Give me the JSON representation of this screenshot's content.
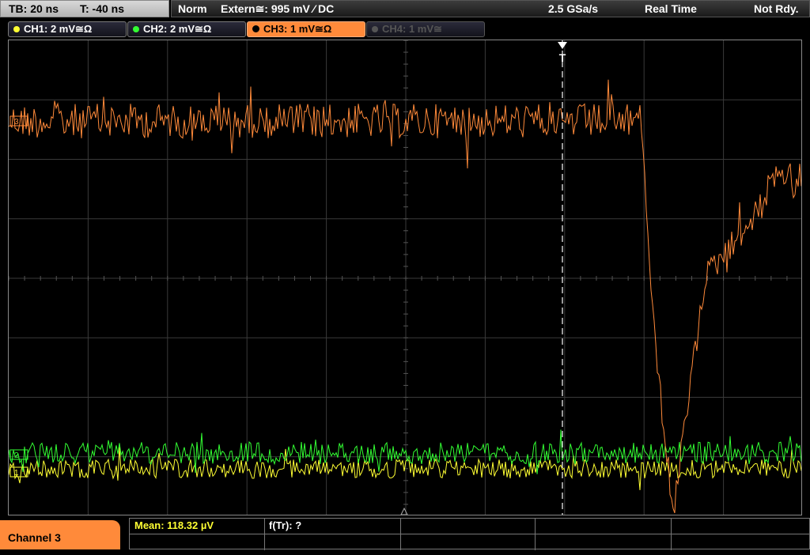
{
  "topbar": {
    "timebase": "TB: 20 ns",
    "trigger_offset": "T: -40 ns",
    "mode": "Norm",
    "trigger_source": "Extern≅: 995 mV ⁄ DC",
    "sample_rate": "2.5 GSa/s",
    "acquisition": "Real Time",
    "status": "Not Rdy."
  },
  "channels": [
    {
      "label": "CH1: 2 mV≅Ω",
      "color": "#ffff33"
    },
    {
      "label": "CH2: 2 mV≅Ω",
      "color": "#33ff33"
    },
    {
      "label": "CH3: 1 mV≅Ω",
      "color": "#ff8a3a"
    },
    {
      "label": "CH4: 1 mV≅",
      "color": "#555555"
    }
  ],
  "screen": {
    "trigger_marker": "T",
    "ch3_marker": "3",
    "ch2_marker": "2",
    "ch1_marker": "1"
  },
  "bottom": {
    "active_channel": "Channel 3",
    "mean_label": "Mean: 118.32 µV",
    "ftr_label": "f(Tr): ?"
  },
  "colors": {
    "ch1": "#ffff33",
    "ch2": "#33ff33",
    "ch3": "#ff8a3a",
    "grid": "#3a3a3a",
    "accent": "#ff8a3a"
  }
}
